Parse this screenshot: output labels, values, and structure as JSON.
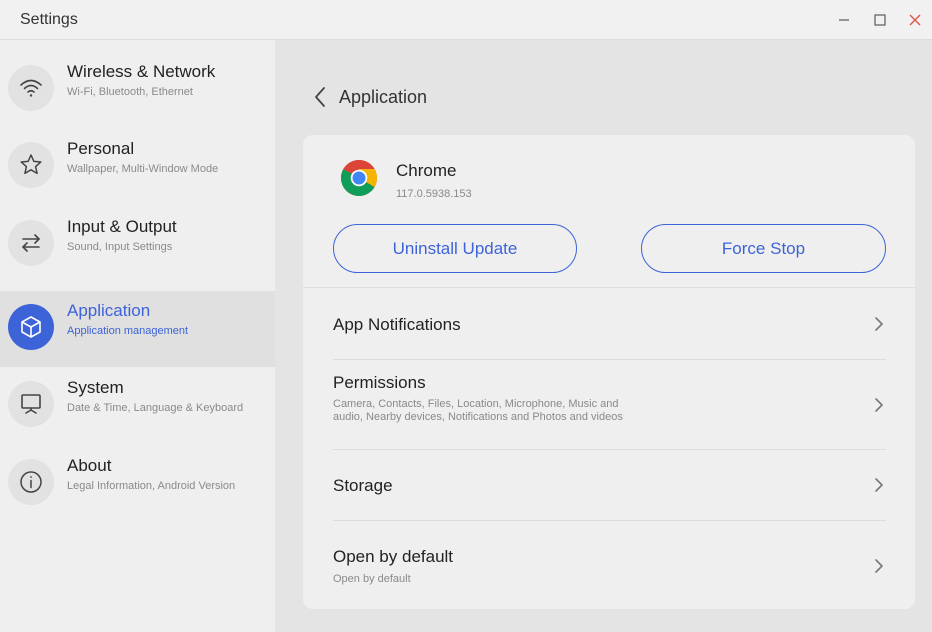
{
  "window": {
    "title": "Settings",
    "controls": [
      "minimize",
      "maximize",
      "close"
    ]
  },
  "colors": {
    "accent": "#3d63d8",
    "close": "#e2574c"
  },
  "sidebar": {
    "items": [
      {
        "label": "Wireless & Network",
        "sub": "Wi-Fi, Bluetooth, Ethernet",
        "icon": "wifi-icon",
        "active": false
      },
      {
        "label": "Personal",
        "sub": "Wallpaper, Multi-Window Mode",
        "icon": "star-icon",
        "active": false
      },
      {
        "label": "Input & Output",
        "sub": "Sound, Input Settings",
        "icon": "arrows-swap-icon",
        "active": false
      },
      {
        "label": "Application",
        "sub": "Application management",
        "icon": "cube-icon",
        "active": true
      },
      {
        "label": "System",
        "sub": "Date & Time, Language & Keyboard",
        "icon": "monitor-icon",
        "active": false
      },
      {
        "label": "About",
        "sub": "Legal Information, Android Version",
        "icon": "info-icon",
        "active": false
      }
    ]
  },
  "header": {
    "title": "Application"
  },
  "app": {
    "name": "Chrome",
    "version": "117.0.5938.153",
    "icon": "chrome-icon"
  },
  "buttons": {
    "uninstall": "Uninstall Update",
    "force_stop": "Force Stop"
  },
  "rows": [
    {
      "label": "App Notifications",
      "sub": ""
    },
    {
      "label": "Permissions",
      "sub": "Camera, Contacts, Files, Location, Microphone, Music and audio, Nearby devices, Notifications and Photos and videos"
    },
    {
      "label": "Storage",
      "sub": ""
    },
    {
      "label": "Open by default",
      "sub": "Open by default"
    }
  ]
}
